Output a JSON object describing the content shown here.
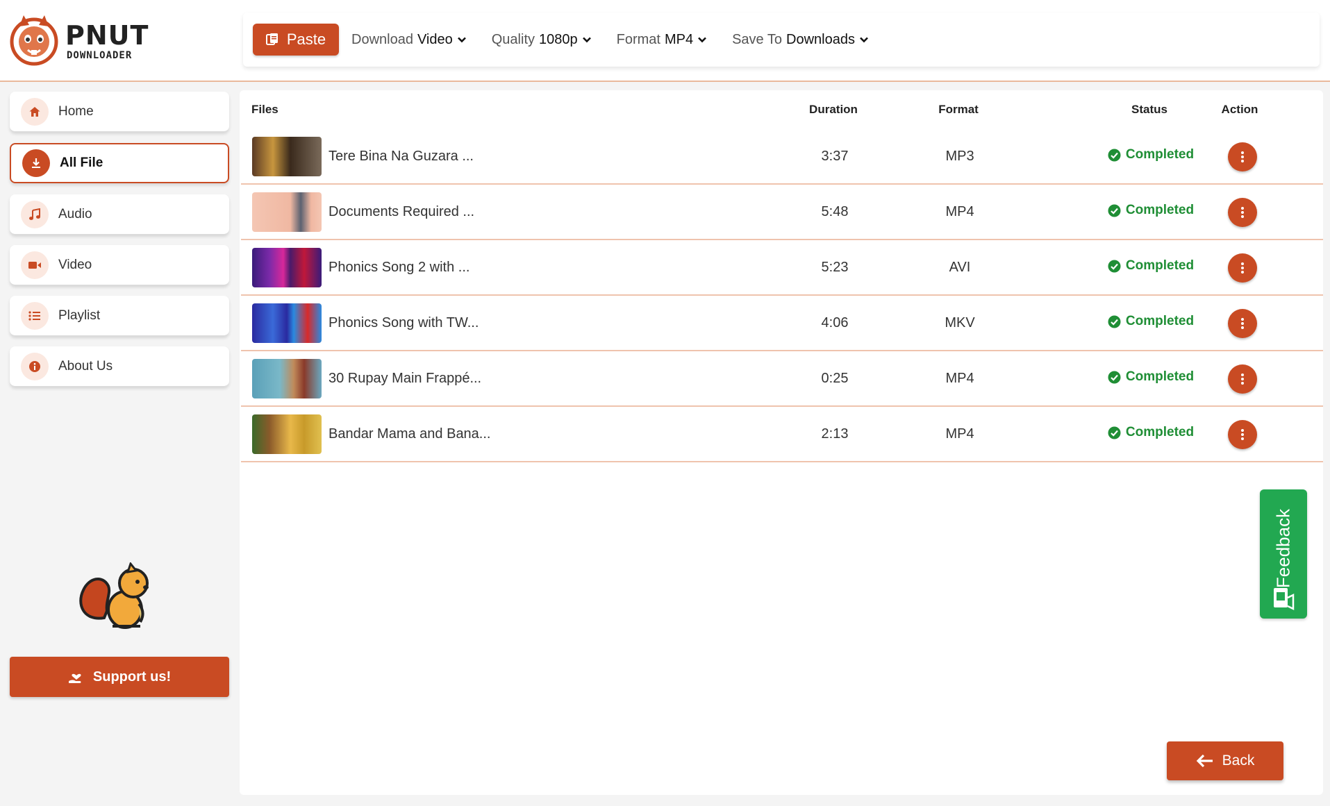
{
  "brand": {
    "name": "PNUT",
    "sub": "DOWNLOADER"
  },
  "toolbar": {
    "paste_label": "Paste",
    "download": {
      "label": "Download",
      "value": "Video"
    },
    "quality": {
      "label": "Quality",
      "value": "1080p"
    },
    "format": {
      "label": "Format",
      "value": "MP4"
    },
    "save_to": {
      "label": "Save To",
      "value": "Downloads"
    }
  },
  "sidebar": {
    "items": [
      {
        "label": "Home",
        "icon": "home-icon"
      },
      {
        "label": "All File",
        "icon": "download-icon",
        "active": true
      },
      {
        "label": "Audio",
        "icon": "music-icon"
      },
      {
        "label": "Video",
        "icon": "video-icon"
      },
      {
        "label": "Playlist",
        "icon": "list-icon"
      },
      {
        "label": "About Us",
        "icon": "info-icon"
      }
    ],
    "support_label": "Support us!"
  },
  "table": {
    "headers": {
      "files": "Files",
      "duration": "Duration",
      "format": "Format",
      "status": "Status",
      "action": "Action"
    },
    "rows": [
      {
        "name": "Tere Bina Na Guzara ...",
        "duration": "3:37",
        "format": "MP3",
        "status": "Completed"
      },
      {
        "name": "Documents Required ...",
        "duration": "5:48",
        "format": "MP4",
        "status": "Completed"
      },
      {
        "name": "Phonics Song 2 with ...",
        "duration": "5:23",
        "format": "AVI",
        "status": "Completed"
      },
      {
        "name": "Phonics Song with TW...",
        "duration": "4:06",
        "format": "MKV",
        "status": "Completed"
      },
      {
        "name": "30 Rupay Main Frappé...",
        "duration": "0:25",
        "format": "MP4",
        "status": "Completed"
      },
      {
        "name": "Bandar Mama and Bana...",
        "duration": "2:13",
        "format": "MP4",
        "status": "Completed"
      }
    ]
  },
  "feedback_label": "Feedback",
  "back_label": "Back",
  "colors": {
    "accent": "#c94b23",
    "success": "#1f8e35",
    "feedback": "#22a851"
  }
}
